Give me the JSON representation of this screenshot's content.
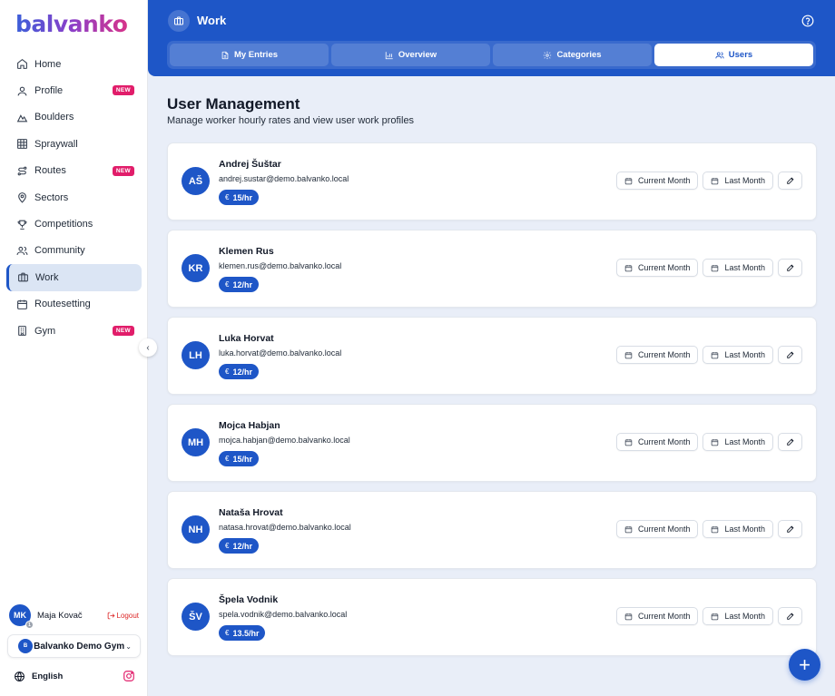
{
  "app": {
    "logo_text": "balvanko"
  },
  "sidebar": {
    "items": [
      {
        "label": "Home",
        "icon": "home-icon",
        "badge": ""
      },
      {
        "label": "Profile",
        "icon": "user-icon",
        "badge": "NEW"
      },
      {
        "label": "Boulders",
        "icon": "mountain-icon",
        "badge": ""
      },
      {
        "label": "Spraywall",
        "icon": "grid-icon",
        "badge": ""
      },
      {
        "label": "Routes",
        "icon": "route-icon",
        "badge": "NEW"
      },
      {
        "label": "Sectors",
        "icon": "map-pin-icon",
        "badge": ""
      },
      {
        "label": "Competitions",
        "icon": "trophy-icon",
        "badge": ""
      },
      {
        "label": "Community",
        "icon": "users-icon",
        "badge": ""
      },
      {
        "label": "Work",
        "icon": "briefcase-icon",
        "badge": "",
        "active": true
      },
      {
        "label": "Routesetting",
        "icon": "calendar-icon",
        "badge": ""
      },
      {
        "label": "Gym",
        "icon": "building-icon",
        "badge": "NEW"
      }
    ],
    "user": {
      "initials": "MK",
      "mini_badge": "1",
      "name": "Maja Kovač",
      "logout_label": "Logout"
    },
    "gym": {
      "initial": "B",
      "name": "Balvanko Demo Gym"
    },
    "language": "English"
  },
  "header": {
    "title": "Work",
    "tabs": [
      {
        "label": "My Entries",
        "icon": "document-icon"
      },
      {
        "label": "Overview",
        "icon": "bar-chart-icon"
      },
      {
        "label": "Categories",
        "icon": "settings-icon"
      },
      {
        "label": "Users",
        "icon": "users-icon",
        "active": true
      }
    ]
  },
  "main": {
    "title": "User Management",
    "subtitle": "Manage worker hourly rates and view user work profiles",
    "current_month_label": "Current Month",
    "last_month_label": "Last Month",
    "users": [
      {
        "initials": "AŠ",
        "name": "Andrej Šuštar",
        "email": "andrej.sustar@demo.balvanko.local",
        "rate": "€15/hr"
      },
      {
        "initials": "KR",
        "name": "Klemen Rus",
        "email": "klemen.rus@demo.balvanko.local",
        "rate": "€12/hr"
      },
      {
        "initials": "LH",
        "name": "Luka Horvat",
        "email": "luka.horvat@demo.balvanko.local",
        "rate": "€12/hr"
      },
      {
        "initials": "MH",
        "name": "Mojca Habjan",
        "email": "mojca.habjan@demo.balvanko.local",
        "rate": "€15/hr"
      },
      {
        "initials": "NH",
        "name": "Nataša Hrovat",
        "email": "natasa.hrovat@demo.balvanko.local",
        "rate": "€12/hr"
      },
      {
        "initials": "ŠV",
        "name": "Špela Vodnik",
        "email": "spela.vodnik@demo.balvanko.local",
        "rate": "€13.5/hr"
      }
    ]
  },
  "colors": {
    "primary": "#1e56c7",
    "badge": "#e11d6a",
    "logout": "#dc2626",
    "background": "#e9eef8"
  }
}
